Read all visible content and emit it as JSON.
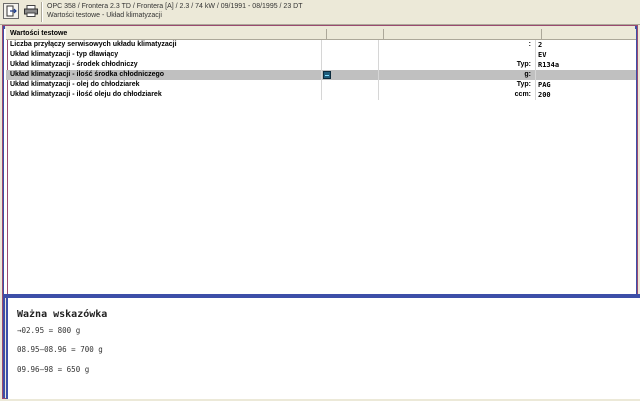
{
  "toolbar": {
    "exit_icon": "exit-door-icon",
    "print_icon": "printer-icon"
  },
  "vehicle": {
    "line1": "OPC 358 / Frontera 2.3 TD / Frontera [A] / 2.3 / 74 kW / 09/1991 - 08/1995 / 23 DT",
    "line2": "Wartości testowe - Układ klimatyzacji"
  },
  "table": {
    "header": "Wartości testowe",
    "rows": [
      {
        "label": "Liczba przyłączy serwisowych układu klimatyzacji",
        "unit": ":",
        "value": "2"
      },
      {
        "label": "Układ klimatyzacji - typ dławiący",
        "unit": "",
        "value": "EV"
      },
      {
        "label": "Układ klimatyzacji - środek chłodniczy",
        "unit": "Typ:",
        "value": "R134a"
      },
      {
        "label": "Układ klimatyzacji - ilość środka chłodniczego",
        "unit": "g:",
        "value": ""
      },
      {
        "label": "Układ klimatyzacji - olej do chłodziarek",
        "unit": "Typ:",
        "value": "PAG"
      },
      {
        "label": "Układ klimatyzacji - ilość oleju do chłodziarek",
        "unit": "ccm:",
        "value": "200"
      }
    ]
  },
  "hint": {
    "title": "Ważna wskazówka",
    "lines": [
      "→02.95 = 800 g",
      "08.95–08.96 = 700 g",
      "09.96–98 = 650 g"
    ]
  },
  "colors": {
    "frame_blue": "#3d4fa8",
    "frame_maroon": "#9a4a70",
    "selection": "#c0c0c0"
  }
}
